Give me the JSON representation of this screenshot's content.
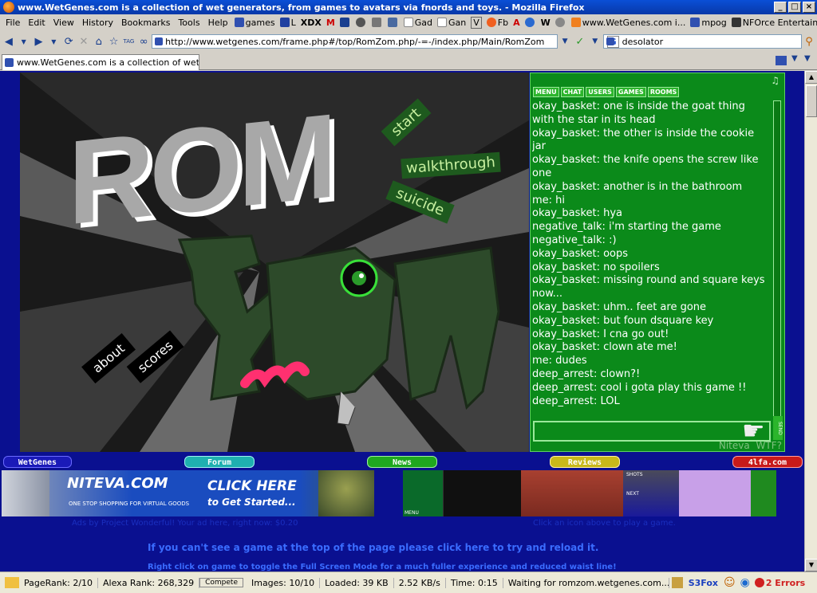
{
  "window": {
    "title": "www.WetGenes.com is a collection of wet generators, from games to avatars via fnords and toys. - Mozilla Firefox",
    "controls": [
      "_",
      "□",
      "×"
    ]
  },
  "menubar": {
    "items": [
      "File",
      "Edit",
      "View",
      "History",
      "Bookmarks",
      "Tools",
      "Help"
    ],
    "bookmarks": [
      "games",
      "L",
      "XDX",
      "M",
      "",
      "",
      "",
      "",
      "Gad",
      "Gan",
      "V",
      "Fb",
      "A",
      "",
      "W",
      "",
      "www.WetGenes.com i...",
      "mpog",
      "NFOrce Entertainment"
    ]
  },
  "navbar": {
    "url": "http://www.wetgenes.com/frame.php#/top/RomZom.php/-=-/index.php/Main/RomZom",
    "search_value": "desolator",
    "search_engine": "G"
  },
  "tab": {
    "label": "www.WetGenes.com is a collection of wet ge..."
  },
  "game": {
    "title_rom": "ROM",
    "title_zom": "ZOM",
    "buttons": [
      "start",
      "walkthrough",
      "suicide",
      "about",
      "scores"
    ]
  },
  "chat": {
    "tabs": [
      "MENU",
      "CHAT",
      "USERS",
      "GAMES",
      "ROOMS"
    ],
    "music_icon": "♫",
    "messages": [
      "okay_basket: one is inside the goat thing with the star in its head",
      "okay_basket: the other is inside the cookie jar",
      "okay_basket: the knife opens the screw like one",
      "okay_basket: another is in the bathroom",
      "me: hi",
      "okay_basket: hya",
      "negative_talk: i'm starting the game",
      "negative_talk: :)",
      "okay_basket: oops",
      "okay_basket: no spoilers",
      "okay_basket: missing round and square keys now...",
      "okay_basket: uhm.. feet are gone",
      "okay_basket: but foun dsquare key",
      "okay_basket: I cna go out!",
      "okay_basket: clown ate me!",
      "me: dudes",
      "deep_arrest: clown?!",
      "deep_arrest: cool i gota play this game !!",
      "deep_arrest: LOL"
    ],
    "send_label": "SEND",
    "footer_brand": "Niteva",
    "footer_wtf": "WTF?"
  },
  "site_nav": {
    "items": [
      {
        "label": "WetGenes",
        "color": "#1a1ab8"
      },
      {
        "label": "Forum",
        "color": "#1fb0b0"
      },
      {
        "label": "News",
        "color": "#1fa81f"
      },
      {
        "label": "Reviews",
        "color": "#c8b81a"
      },
      {
        "label": "4lfa.com",
        "color": "#c81a1a"
      }
    ]
  },
  "ad": {
    "brand": "NITEVA.COM",
    "tagline": "ONE STOP SHOPPING FOR VIRTUAL GOODS",
    "cta_line1": "CLICK HERE",
    "cta_line2": "to Get Started...",
    "caption": "Ads by Project Wonderful! Your ad here, right now: $0.20"
  },
  "games_thumbs": {
    "caption": "Click an icon above to play a game.",
    "thumb_labels": [
      "MENU",
      "",
      "",
      "SHOTS",
      "NEXT",
      ""
    ]
  },
  "page_text": {
    "reload_hint": "If you can't see a game at the top of the page please click here to try and reload it.",
    "fullscreen_hint": "Right click on game to toggle the Full Screen Mode for a much fuller experience and reduced waist line!"
  },
  "statusbar": {
    "pagerank": "PageRank: 2/10",
    "alexa": "Alexa Rank: 268,329",
    "compete": "Compete",
    "images": "Images: 10/10",
    "loaded": "Loaded: 39 KB",
    "speed": "2.52 KB/s",
    "time": "Time: 0:15",
    "waiting": "Waiting for romzom.wetgenes.com...",
    "s3fox": "S3Fox",
    "errors": "2 Errors"
  }
}
